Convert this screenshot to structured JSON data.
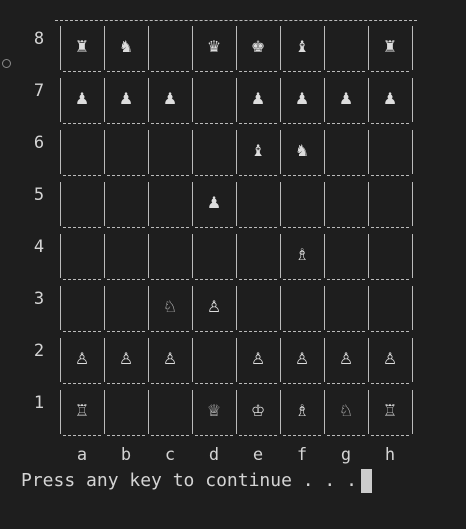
{
  "board": {
    "ranks": [
      "8",
      "7",
      "6",
      "5",
      "4",
      "3",
      "2",
      "1"
    ],
    "files": [
      "a",
      "b",
      "c",
      "d",
      "e",
      "f",
      "g",
      "h"
    ],
    "rows": [
      [
        "♜",
        "♞",
        "",
        "♛",
        "♚",
        "♝",
        "",
        "♜"
      ],
      [
        "♟",
        "♟",
        "♟",
        "",
        "♟",
        "♟",
        "♟",
        "♟"
      ],
      [
        "",
        "",
        "",
        "",
        "♝",
        "♞",
        "",
        ""
      ],
      [
        "",
        "",
        "",
        "♟",
        "",
        "",
        "",
        ""
      ],
      [
        "",
        "",
        "",
        "",
        "",
        "♗",
        "",
        ""
      ],
      [
        "",
        "",
        "♘",
        "♙",
        "",
        "",
        "",
        ""
      ],
      [
        "♙",
        "♙",
        "♙",
        "",
        "♙",
        "♙",
        "♙",
        "♙"
      ],
      [
        "♖",
        "",
        "",
        "♕",
        "♔",
        "♗",
        "♘",
        "♖"
      ]
    ]
  },
  "terminal": {
    "prompt": "Press any key to continue . . ."
  },
  "colors": {
    "background": "#1e1e1e",
    "text": "#d4d4d4",
    "grid": "#bbbbbb"
  }
}
